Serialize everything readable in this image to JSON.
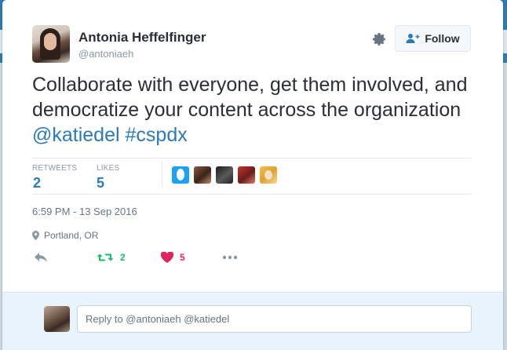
{
  "author": {
    "name": "Antonia Heffelfinger",
    "handle": "@antoniaeh"
  },
  "follow_button": {
    "label": "Follow"
  },
  "tweet": {
    "text": "Collaborate with everyone, get them involved, and democratize your content across the organization ",
    "mention": "@katiedel",
    "hashtag": "#cspdx"
  },
  "stats": {
    "retweets_label": "RETWEETS",
    "retweets_value": "2",
    "likes_label": "LIKES",
    "likes_value": "5"
  },
  "timestamp": "6:59 PM - 13 Sep 2016",
  "location": "Portland, OR",
  "actions": {
    "retweet_count": "2",
    "like_count": "5"
  },
  "reply": {
    "placeholder": "Reply to @antoniaeh @katiedel"
  },
  "colors": {
    "link": "#2b7bb9",
    "retweet_green": "#17bf63",
    "like_red": "#e0245e",
    "muted": "#8899a6"
  },
  "icons": [
    "gear-icon",
    "follow-person-icon",
    "location-pin-icon",
    "reply-icon",
    "retweet-icon",
    "heart-icon",
    "more-icon"
  ]
}
